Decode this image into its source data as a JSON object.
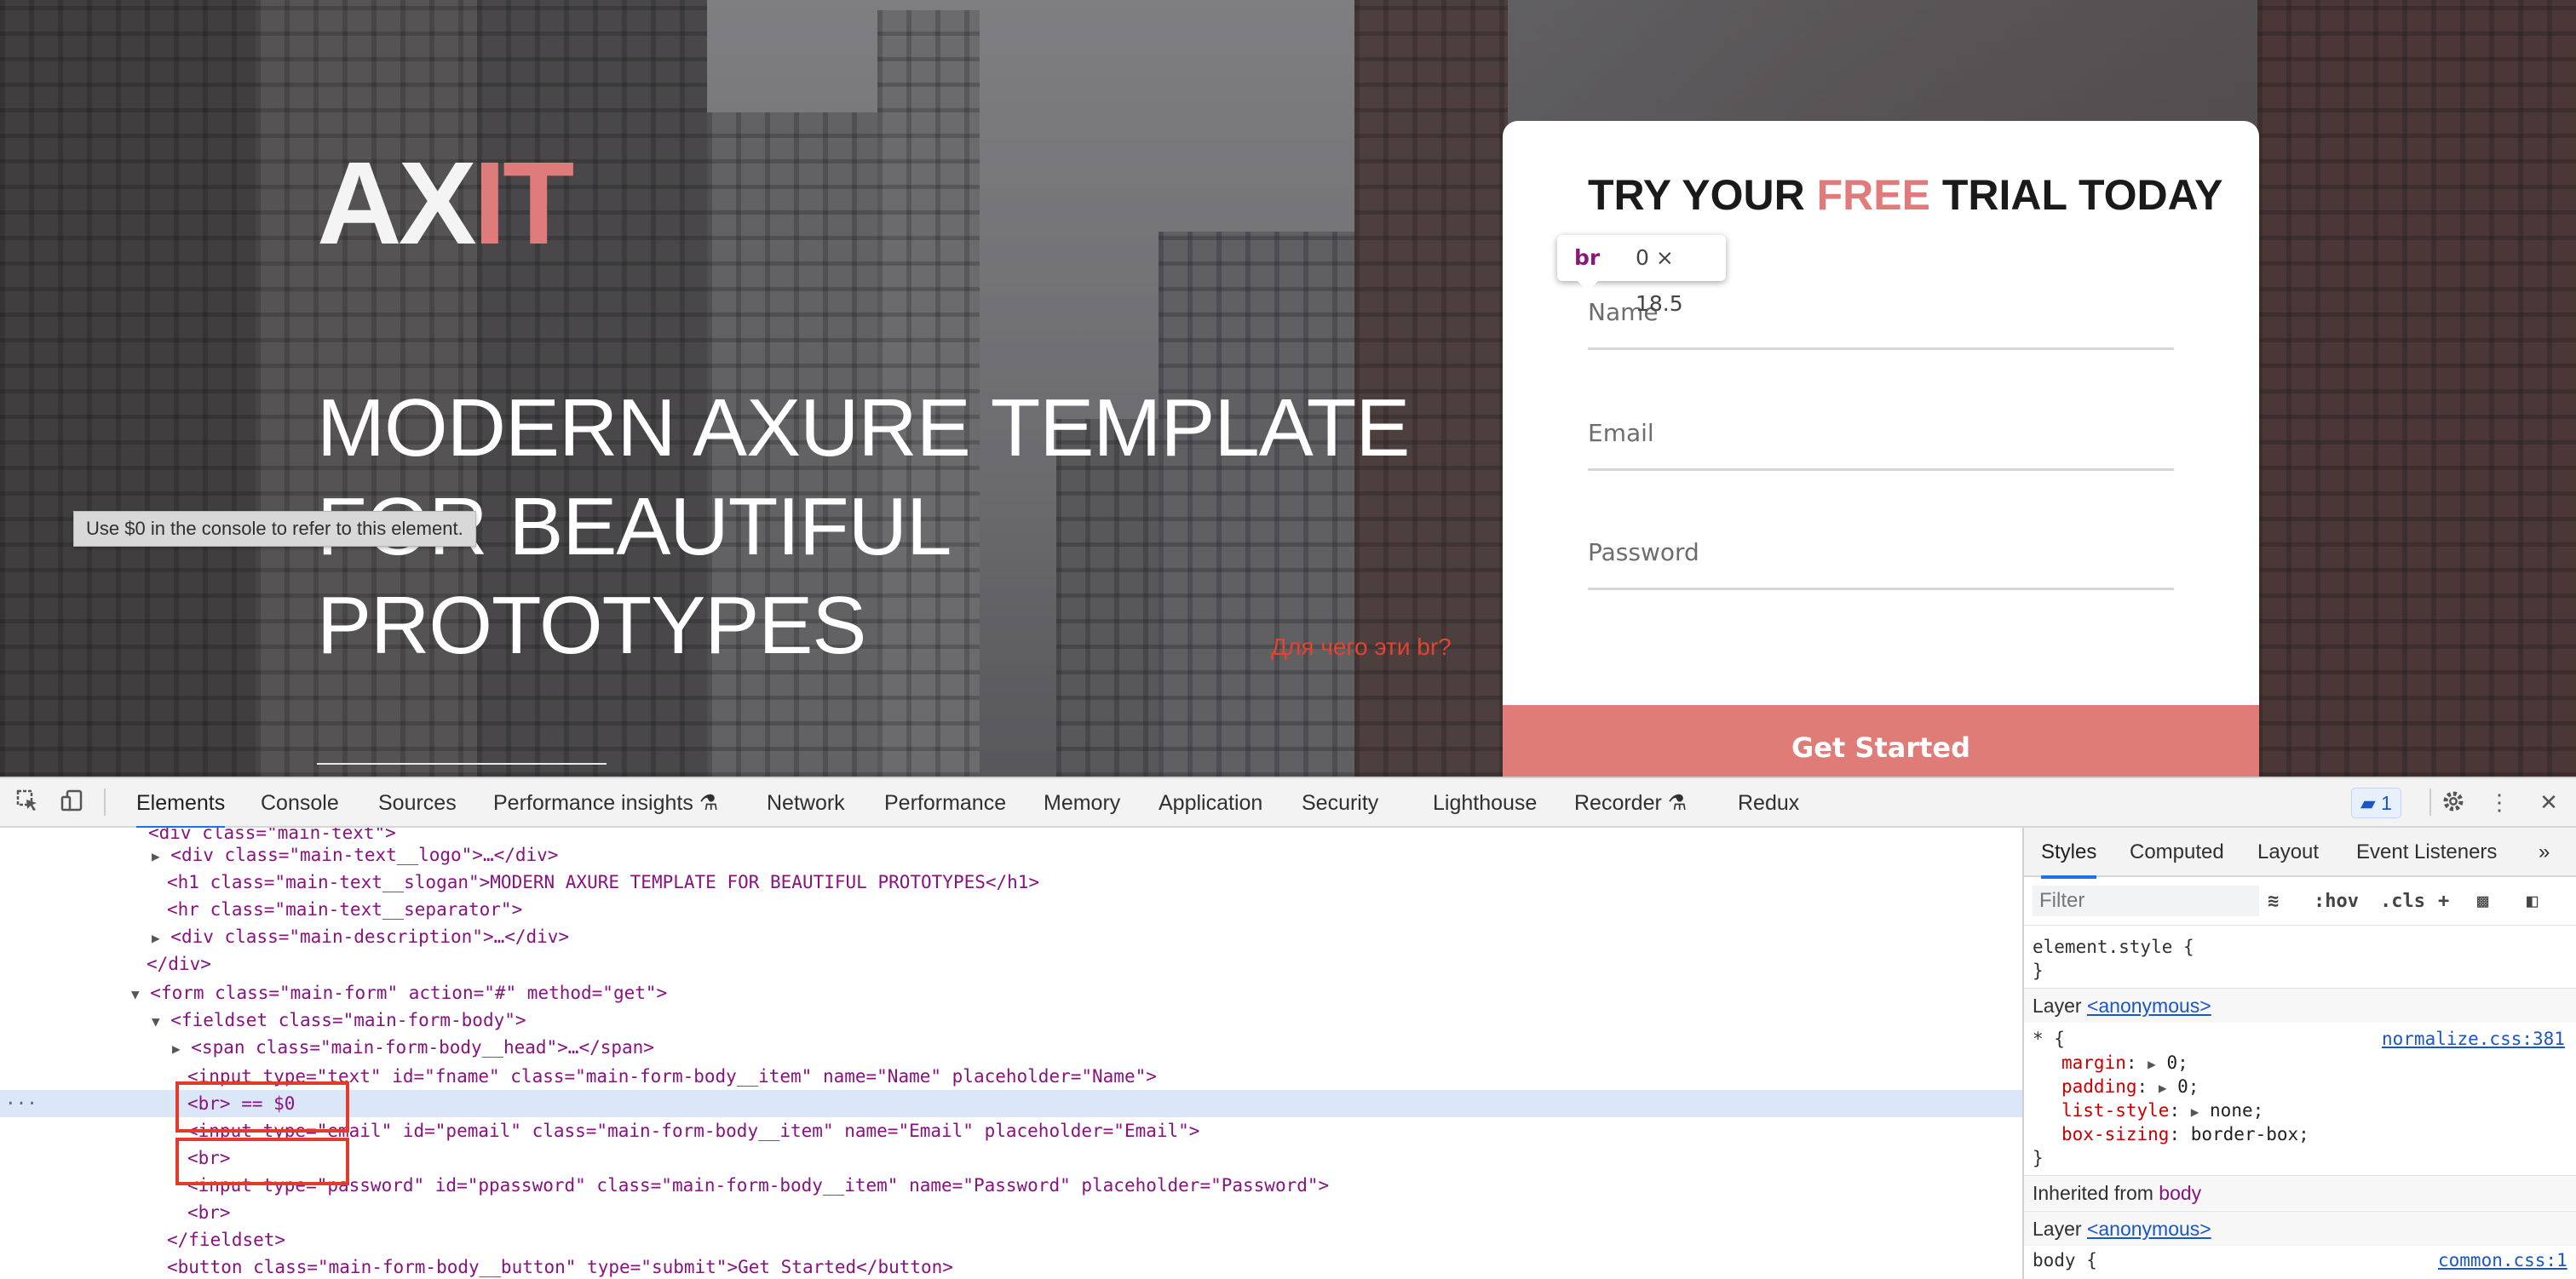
{
  "page": {
    "logo_main": "AX",
    "logo_accent": "IT",
    "slogan": "MODERN AXURE TEMPLATE FOR BEAUTIFUL PROTOTYPES",
    "annotation": "Для чего эти br?",
    "console_hint": "Use $0 in the console to refer to this element.",
    "form": {
      "head_before": "TRY YOUR ",
      "head_free": "FREE",
      "head_after": " TRIAL TODAY",
      "name_placeholder": "Name",
      "email_placeholder": "Email",
      "password_placeholder": "Password",
      "submit_label": "Get Started"
    },
    "inspect_tooltip": {
      "tag": "br",
      "size": "0 × 18.5"
    },
    "colors": {
      "accent": "#e07b7b",
      "annotation": "#e2442f"
    }
  },
  "devtools": {
    "tabs": [
      "Elements",
      "Console",
      "Sources",
      "Performance insights",
      "Network",
      "Performance",
      "Memory",
      "Application",
      "Security",
      "Lighthouse",
      "Recorder",
      "Redux"
    ],
    "active_tab": "Elements",
    "issues_badge": "1",
    "dom_lines": [
      "<div class=\"main-text\">",
      "<div class=\"main-text__logo\">…</div>",
      "<h1 class=\"main-text__slogan\">MODERN AXURE TEMPLATE FOR BEAUTIFUL PROTOTYPES</h1>",
      "<hr class=\"main-text__separator\">",
      "<div class=\"main-description\">…</div>",
      "</div>",
      "<form class=\"main-form\" action=\"#\" method=\"get\">",
      "<fieldset class=\"main-form-body\">",
      "<span class=\"main-form-body__head\">…</span>",
      "<input type=\"text\" id=\"fname\" class=\"main-form-body__item\" name=\"Name\" placeholder=\"Name\">",
      "<br> == $0",
      "<input type=\"email\" id=\"pemail\" class=\"main-form-body__item\" name=\"Email\" placeholder=\"Email\">",
      "<br>",
      "<input type=\"password\" id=\"ppassword\" class=\"main-form-body__item\" name=\"Password\" placeholder=\"Password\">",
      "<br>",
      "</fieldset>",
      "<button class=\"main-form-body__button\" type=\"submit\">Get Started</button>"
    ],
    "styles": {
      "tabs": [
        "Styles",
        "Computed",
        "Layout",
        "Event Listeners"
      ],
      "active_tab": "Styles",
      "filter_placeholder": "Filter",
      "hov_label": ":hov",
      "cls_label": ".cls",
      "element_style": "element.style {",
      "closing_brace": "}",
      "layer_label": "Layer",
      "layer_name": "<anonymous>",
      "rule_selector": "* {",
      "rule_source": "normalize.css:381",
      "declarations": [
        {
          "prop": "margin",
          "value": "0"
        },
        {
          "prop": "padding",
          "value": "0"
        },
        {
          "prop": "list-style",
          "value": "none"
        },
        {
          "prop": "box-sizing",
          "value": "border-box"
        }
      ],
      "inherited_label": "Inherited from",
      "inherited_from": "body",
      "body_rule": "body {",
      "body_source": "common.css:1"
    }
  }
}
